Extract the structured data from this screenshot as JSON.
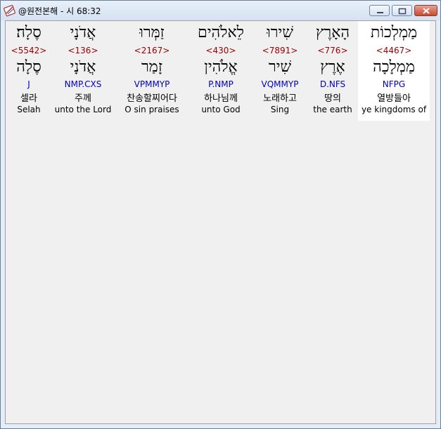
{
  "window": {
    "title": "@원전본해 - 시 68:32",
    "app_icon": "bible-app-icon",
    "buttons": [
      "minimize-icon",
      "maximize-icon",
      "close-icon"
    ],
    "selected_color": "#ffffff",
    "strong_color": "#a00000",
    "morph_color": "#0000c0"
  },
  "words": [
    {
      "hebrew": "סֶלָה׃",
      "strong": "<5542>",
      "lemma": "סֶלָה",
      "morph": "J",
      "korean": "셀라",
      "english": "Selah"
    },
    {
      "hebrew": "אֲדֹנָי",
      "strong": "<136>",
      "lemma": "אֲדֹנָי",
      "morph": "NMP.CXS",
      "korean": "주께",
      "english": "unto the Lord"
    },
    {
      "hebrew": "זַמְּרוּ",
      "strong": "<2167>",
      "lemma": "זָמַר",
      "morph": "VPMMYP",
      "korean": "찬송할찌어다",
      "english": "O sin praises"
    },
    {
      "hebrew": "לֵאלֹהִים",
      "strong": "<430>",
      "lemma": "אֱלֹהִין",
      "morph": "P.NMP",
      "korean": "하나님께",
      "english": "unto God"
    },
    {
      "hebrew": "שִׁירוּ",
      "strong": "<7891>",
      "lemma": "שִׁיר",
      "morph": "VQMMYP",
      "korean": "노래하고",
      "english": "Sing"
    },
    {
      "hebrew": "הָאָרֶץ",
      "strong": "<776>",
      "lemma": "אֶרֶץ",
      "morph": "D.NFS",
      "korean": "땅의",
      "english": "the earth"
    },
    {
      "hebrew": "מַמְלְכוֹת",
      "strong": "<4467>",
      "lemma": "מַמְלָכָה",
      "morph": "NFPG",
      "korean": "열방들아",
      "english": "ye kingdoms of"
    }
  ]
}
